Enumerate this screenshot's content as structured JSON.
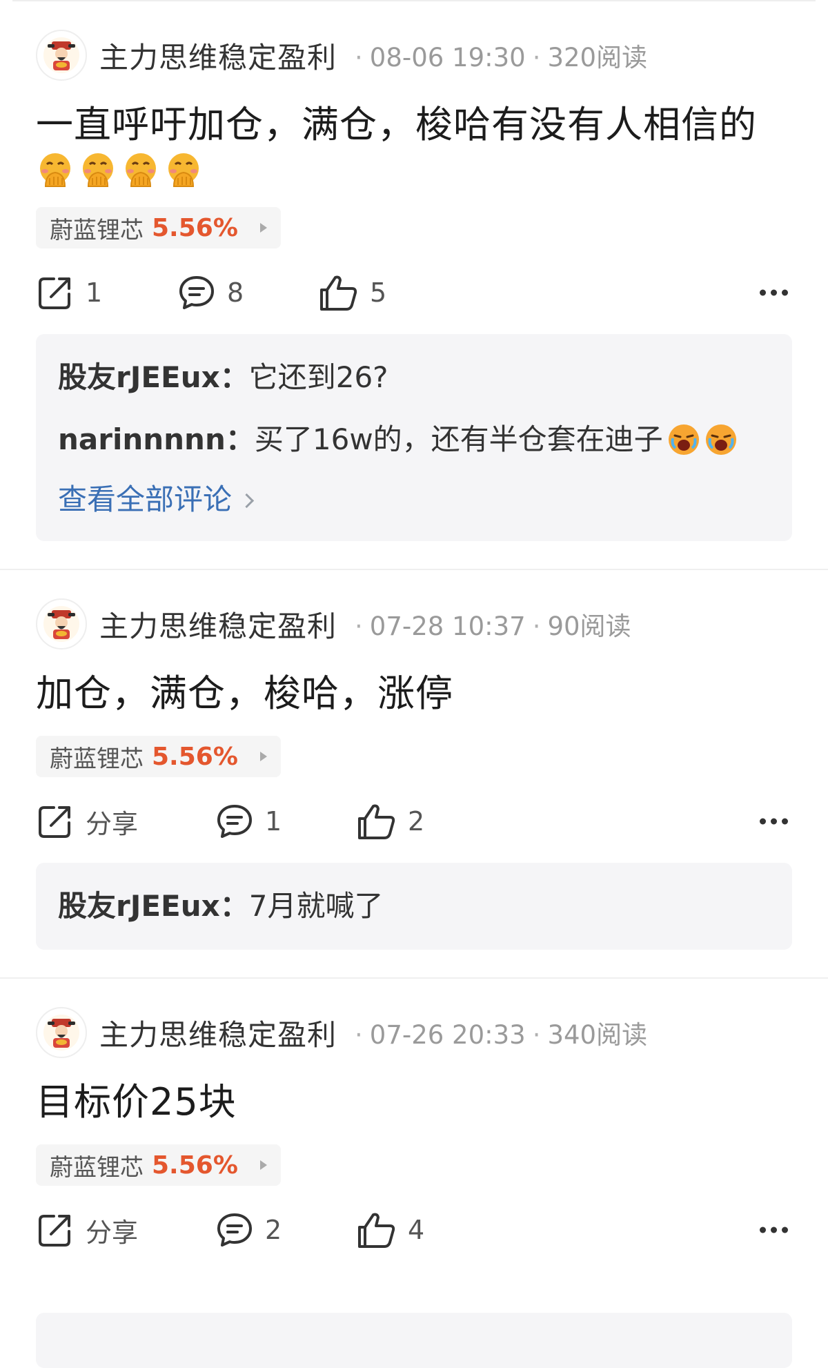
{
  "posts": [
    {
      "author": "主力思维稳定盈利",
      "time": "08-06 19:30",
      "reads": "320阅读",
      "text": "一直呼吁加仓，满仓，梭哈有没有人相信的",
      "emojis": [
        "hand-over-mouth-emoji",
        "hand-over-mouth-emoji",
        "hand-over-mouth-emoji",
        "hand-over-mouth-emoji"
      ],
      "stock": {
        "name": "蔚蓝锂芯",
        "change": "5.56%"
      },
      "share": "1",
      "comment_count": "8",
      "like_count": "5",
      "comments": [
        {
          "user": "股友rJEEux",
          "colon": "：",
          "text": "它还到26?"
        },
        {
          "user": "narinnnnn",
          "colon": "：",
          "text": "买了16w的，还有半仓套在迪子"
        }
      ],
      "view_all": "查看全部评论"
    },
    {
      "author": "主力思维稳定盈利",
      "time": "07-28 10:37",
      "reads": "90阅读",
      "text": "加仓，满仓，梭哈，涨停",
      "stock": {
        "name": "蔚蓝锂芯",
        "change": "5.56%"
      },
      "share": "分享",
      "comment_count": "1",
      "like_count": "2",
      "comments": [
        {
          "user": "股友rJEEux",
          "colon": "：",
          "text": "7月就喊了"
        }
      ]
    },
    {
      "author": "主力思维稳定盈利",
      "time": "07-26 20:33",
      "reads": "340阅读",
      "text": "目标价25块",
      "stock": {
        "name": "蔚蓝锂芯",
        "change": "5.56%"
      },
      "share": "分享",
      "comment_count": "2",
      "like_count": "4"
    }
  ],
  "separator": "·",
  "colors": {
    "stock_up": "#e4572e",
    "link": "#3a6fb5",
    "muted": "#9a9a9a"
  }
}
